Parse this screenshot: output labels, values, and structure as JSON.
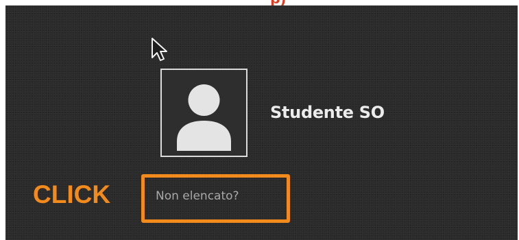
{
  "top_title": {
    "text": "p)"
  },
  "user": {
    "name": "Studente SO",
    "avatar_icon": "user-silhouette-icon"
  },
  "login": {
    "not_listed_label": "Non elencato?"
  },
  "annotation": {
    "click_label": "CLICK",
    "color": "#f28a1c"
  },
  "colors": {
    "background": "#2b2b2b",
    "title_red": "#e23a1e",
    "avatar_fill": "#e4e4e4"
  }
}
